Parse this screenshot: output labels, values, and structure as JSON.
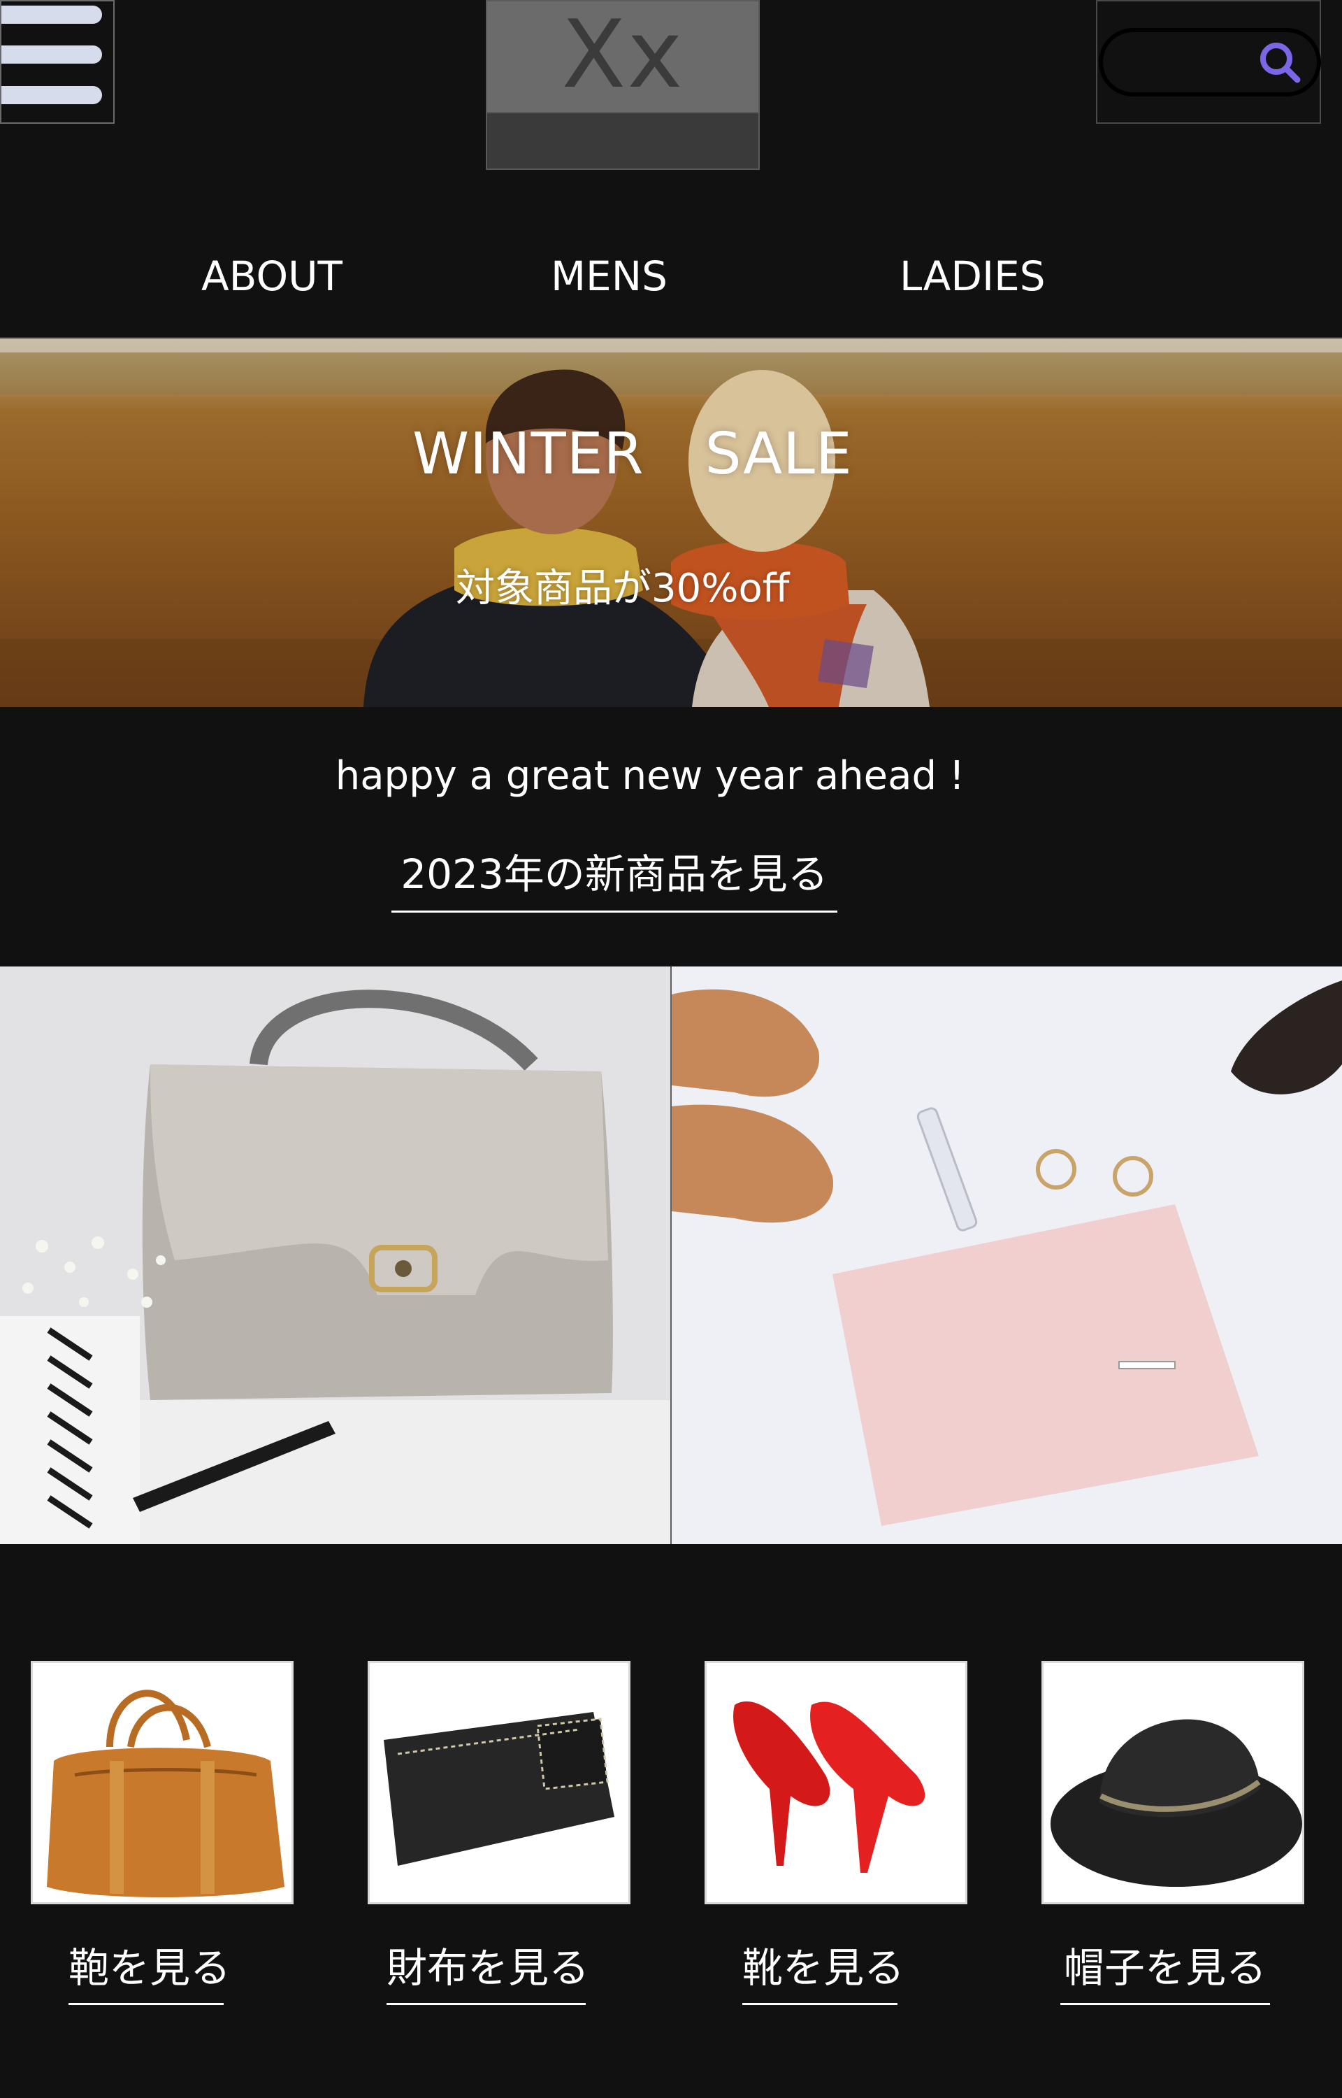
{
  "header": {
    "logo_text": "Xx",
    "search_placeholder": ""
  },
  "nav": {
    "items": [
      "ABOUT",
      "MENS",
      "LADIES"
    ]
  },
  "hero": {
    "title": "WINTER SALE",
    "subtitle": "対象商品が30%off"
  },
  "intro": {
    "tagline": "happy a great new year ahead !",
    "new_items_link": "2023年の新商品を見る"
  },
  "categories": [
    {
      "label": "鞄を見る",
      "icon": "bag"
    },
    {
      "label": "財布を見る",
      "icon": "wallet"
    },
    {
      "label": "靴を見る",
      "icon": "shoes"
    },
    {
      "label": "帽子を見る",
      "icon": "hat"
    }
  ],
  "colors": {
    "background": "#121112",
    "menu_bar": "#d6dcec",
    "search_icon": "#7b66e6",
    "logo_box": "#6b6b6b"
  }
}
